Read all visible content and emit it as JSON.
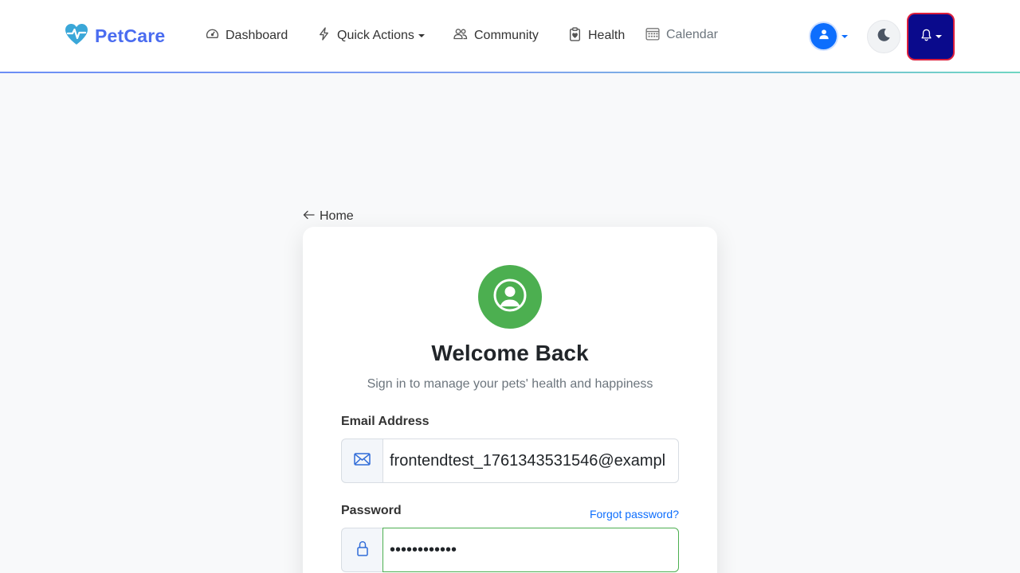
{
  "brand": {
    "name": "PetCare",
    "logo_icon": "heart-pulse-icon",
    "color": "#4a6cf0"
  },
  "nav": {
    "items": [
      {
        "label": "Dashboard",
        "icon": "speedometer-icon"
      },
      {
        "label": "Quick Actions",
        "icon": "lightning-icon",
        "dropdown": true
      },
      {
        "label": "Community",
        "icon": "people-icon"
      },
      {
        "label": "Health",
        "icon": "clipboard-heart-icon"
      },
      {
        "label": "Calendar",
        "icon": "calendar-icon"
      }
    ]
  },
  "header_actions": {
    "user_icon": "person-icon",
    "theme_icon": "moon-icon",
    "notifications_icon": "bell-icon"
  },
  "back_link": {
    "label": "Home",
    "icon": "arrow-left-icon"
  },
  "login": {
    "avatar_icon": "person-circle-icon",
    "title": "Welcome Back",
    "subtitle": "Sign in to manage your pets' health and happiness",
    "email_label": "Email Address",
    "email_value": "frontendtest_1761343531546@exampl",
    "password_label": "Password",
    "forgot_label": "Forgot password?",
    "password_value": "••••••••••••"
  },
  "colors": {
    "accent": "#0d6efd",
    "success": "#4caf50",
    "notification_bg": "#0a0a8c",
    "notification_border": "#dc1e3c"
  }
}
